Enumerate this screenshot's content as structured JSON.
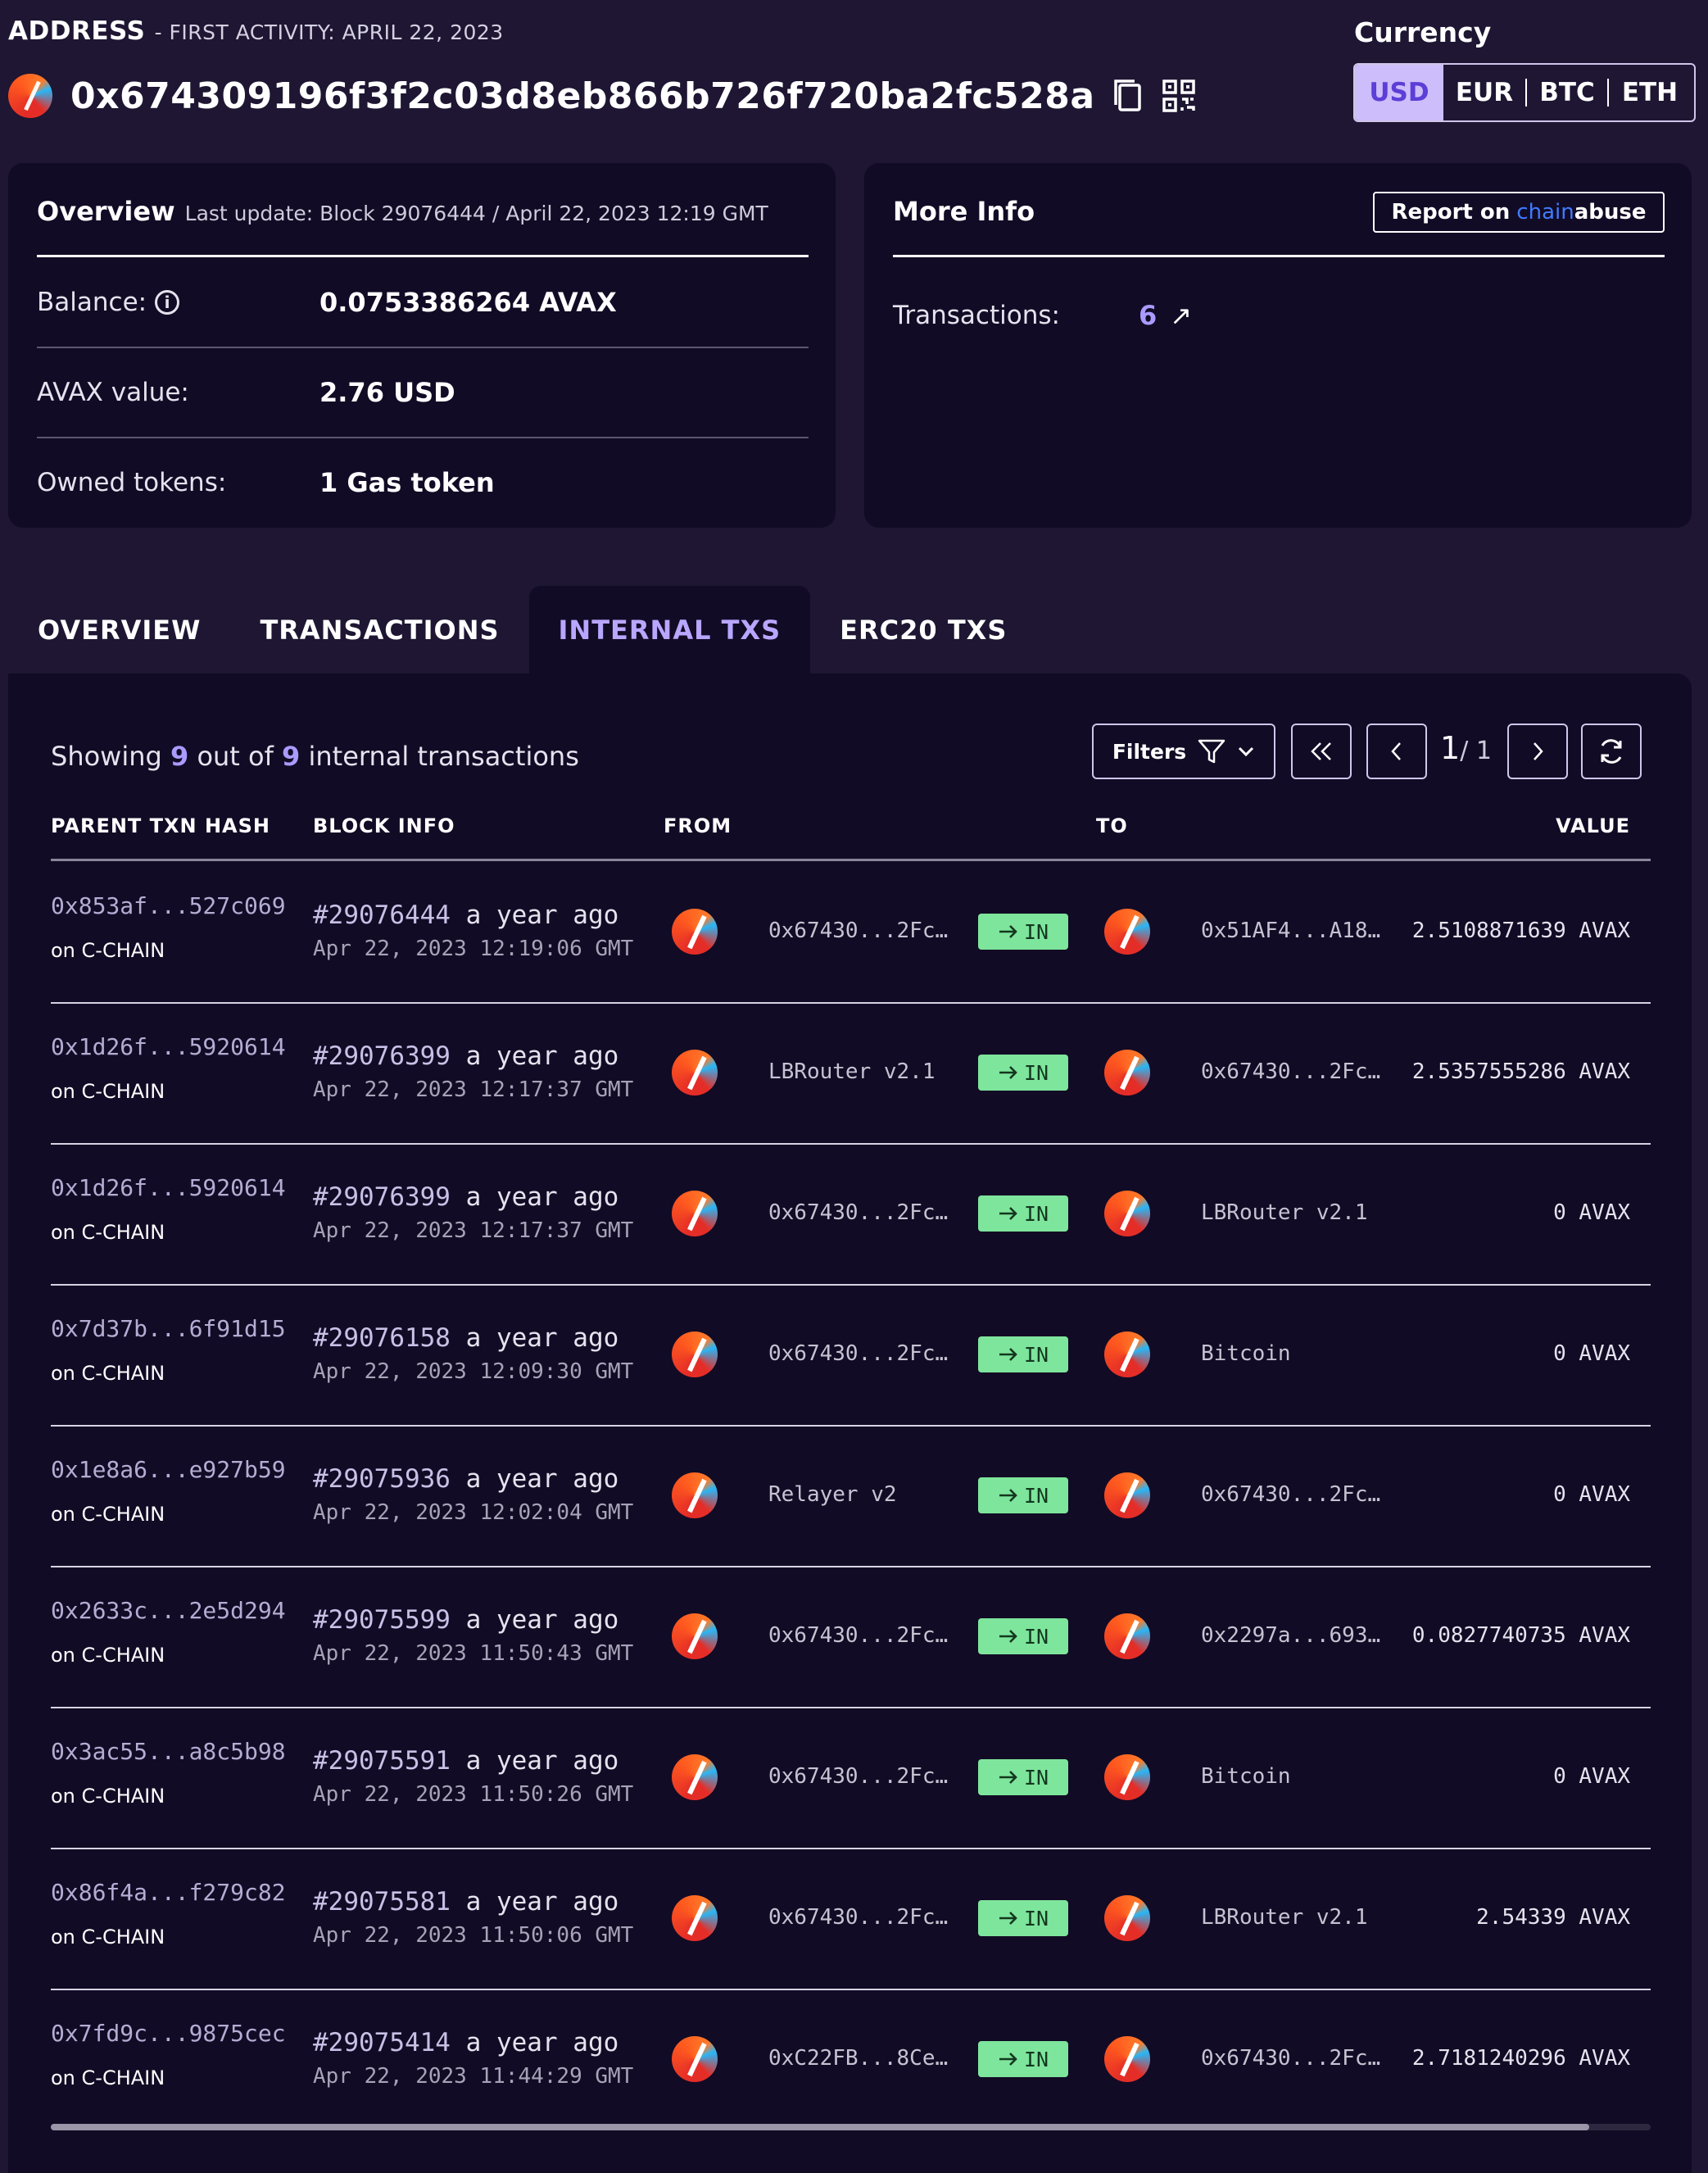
{
  "header": {
    "label": "ADDRESS",
    "first_activity": "- FIRST ACTIVITY: APRIL 22, 2023",
    "address": "0x674309196f3f2c03d8eb866b726f720ba2fc528a",
    "copy_icon": "copy-icon",
    "qr_icon": "qr-code-icon"
  },
  "currency": {
    "title": "Currency",
    "options": [
      "USD",
      "EUR",
      "BTC",
      "ETH"
    ],
    "selected": "USD"
  },
  "overview": {
    "title": "Overview",
    "last_update": "Last update: Block 29076444 / April 22, 2023 12:19 GMT",
    "balance_label": "Balance:",
    "balance_value": "0.0753386264  AVAX",
    "avax_value_label": "AVAX value:",
    "avax_value": "2.76  USD",
    "owned_tokens_label": "Owned tokens:",
    "owned_tokens_value": "1  Gas token"
  },
  "more_info": {
    "title": "More Info",
    "report_prefix": "Report on",
    "report_brand_a": "chain",
    "report_brand_b": "abuse",
    "transactions_label": "Transactions:",
    "transactions_value": "6",
    "transactions_link_icon": "↗"
  },
  "tabs": [
    {
      "label": "OVERVIEW",
      "active": false
    },
    {
      "label": "TRANSACTIONS",
      "active": false
    },
    {
      "label": "INTERNAL TXS",
      "active": true
    },
    {
      "label": "ERC20 TXS",
      "active": false
    }
  ],
  "table": {
    "showing_prefix": "Showing",
    "shown": "9",
    "mid": "out of",
    "total": "9",
    "suffix": "internal transactions",
    "filters_label": "Filters",
    "page_current": "1",
    "page_total": "/ 1",
    "columns": [
      "PARENT TXN HASH",
      "BLOCK INFO",
      "FROM",
      "TO",
      "VALUE"
    ],
    "direction_label": "IN",
    "rows": [
      {
        "hash": "0x853af...527c069",
        "chain": "on C-CHAIN",
        "block": "#29076444",
        "ago": "a year ago",
        "date": "Apr 22, 2023 12:19:06 GMT",
        "from": "0x67430...2Fc…",
        "to": "0x51AF4...A18…",
        "value": "2.5108871639 AVAX"
      },
      {
        "hash": "0x1d26f...5920614",
        "chain": "on C-CHAIN",
        "block": "#29076399",
        "ago": "a year ago",
        "date": "Apr 22, 2023 12:17:37 GMT",
        "from": "LBRouter v2.1",
        "to": "0x67430...2Fc…",
        "value": "2.5357555286 AVAX"
      },
      {
        "hash": "0x1d26f...5920614",
        "chain": "on C-CHAIN",
        "block": "#29076399",
        "ago": "a year ago",
        "date": "Apr 22, 2023 12:17:37 GMT",
        "from": "0x67430...2Fc…",
        "to": "LBRouter v2.1",
        "value": "0 AVAX"
      },
      {
        "hash": "0x7d37b...6f91d15",
        "chain": "on C-CHAIN",
        "block": "#29076158",
        "ago": "a year ago",
        "date": "Apr 22, 2023 12:09:30 GMT",
        "from": "0x67430...2Fc…",
        "to": "Bitcoin",
        "value": "0 AVAX"
      },
      {
        "hash": "0x1e8a6...e927b59",
        "chain": "on C-CHAIN",
        "block": "#29075936",
        "ago": "a year ago",
        "date": "Apr 22, 2023 12:02:04 GMT",
        "from": "Relayer v2",
        "to": "0x67430...2Fc…",
        "value": "0 AVAX"
      },
      {
        "hash": "0x2633c...2e5d294",
        "chain": "on C-CHAIN",
        "block": "#29075599",
        "ago": "a year ago",
        "date": "Apr 22, 2023 11:50:43 GMT",
        "from": "0x67430...2Fc…",
        "to": "0x2297a...693…",
        "value": "0.0827740735 AVAX"
      },
      {
        "hash": "0x3ac55...a8c5b98",
        "chain": "on C-CHAIN",
        "block": "#29075591",
        "ago": "a year ago",
        "date": "Apr 22, 2023 11:50:26 GMT",
        "from": "0x67430...2Fc…",
        "to": "Bitcoin",
        "value": "0 AVAX"
      },
      {
        "hash": "0x86f4a...f279c82",
        "chain": "on C-CHAIN",
        "block": "#29075581",
        "ago": "a year ago",
        "date": "Apr 22, 2023 11:50:06 GMT",
        "from": "0x67430...2Fc…",
        "to": "LBRouter v2.1",
        "value": "2.54339 AVAX"
      },
      {
        "hash": "0x7fd9c...9875cec",
        "chain": "on C-CHAIN",
        "block": "#29075414",
        "ago": "a year ago",
        "date": "Apr 22, 2023 11:44:29 GMT",
        "from": "0xC22FB...8Ce…",
        "to": "0x67430...2Fc…",
        "value": "2.7181240296 AVAX"
      }
    ]
  },
  "colors": {
    "page_bg": "#1e1632",
    "card_bg": "#120b25",
    "accent": "#a99bff",
    "in_badge": "#7ee59c"
  }
}
